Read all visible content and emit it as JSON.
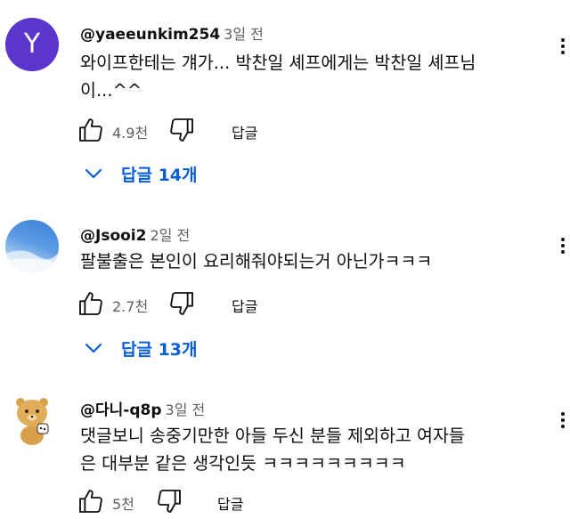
{
  "comments": [
    {
      "avatar_letter": "Y",
      "author": "@yaeeunkim254",
      "time": "3일 전",
      "text_lines": [
        "와이프한테는 걔가... 박찬일 셰프에게는 박찬일 셰프님",
        "이...^^"
      ],
      "likes": "4.9천",
      "reply_label": "답글",
      "replies_label": "답글 14개"
    },
    {
      "author": "@Jsooi2",
      "time": "2일 전",
      "text_lines": [
        "팔불출은 본인이 요리해줘야되는거 아닌가ㅋㅋㅋ"
      ],
      "likes": "2.7천",
      "reply_label": "답글",
      "replies_label": "답글 13개"
    },
    {
      "author": "@다니-q8p",
      "time": "3일 전",
      "text_lines": [
        "댓글보니 송중기만한 아들 두신 분들 제외하고 여자들",
        "은 대부분 같은 생각인듯 ㅋㅋㅋㅋㅋㅋㅋㅋㅋ"
      ],
      "likes": "5천",
      "reply_label": "답글"
    }
  ]
}
